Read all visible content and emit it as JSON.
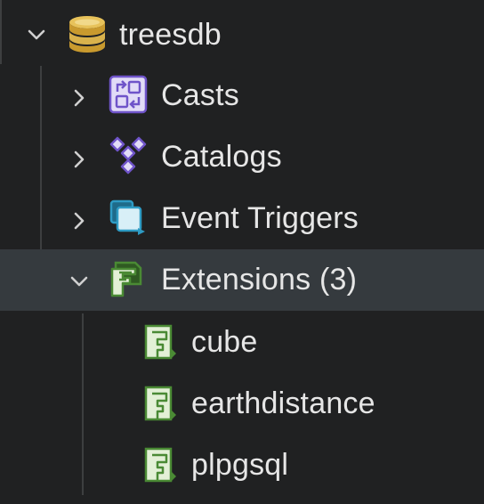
{
  "tree": {
    "root": {
      "label": "treesdb",
      "icon": "database-icon",
      "expanded": true
    },
    "items": [
      {
        "label": "Casts",
        "icon": "casts-icon",
        "expanded": false
      },
      {
        "label": "Catalogs",
        "icon": "catalogs-icon",
        "expanded": false
      },
      {
        "label": "Event Triggers",
        "icon": "event-triggers-icon",
        "expanded": false
      },
      {
        "label": "Extensions (3)",
        "icon": "extensions-icon",
        "expanded": true,
        "selected": true
      }
    ],
    "extensions": [
      {
        "label": "cube",
        "icon": "extension-icon"
      },
      {
        "label": "earthdistance",
        "icon": "extension-icon"
      },
      {
        "label": "plpgsql",
        "icon": "extension-icon"
      }
    ]
  },
  "colors": {
    "background": "#202122",
    "selected_row": "#353a3e",
    "text": "#e6e6e6",
    "guide_line": "#3d3f40",
    "database_gold": "#d9b24c",
    "casts_purple": "#6f54c9",
    "extension_green": "#4a8a34"
  }
}
